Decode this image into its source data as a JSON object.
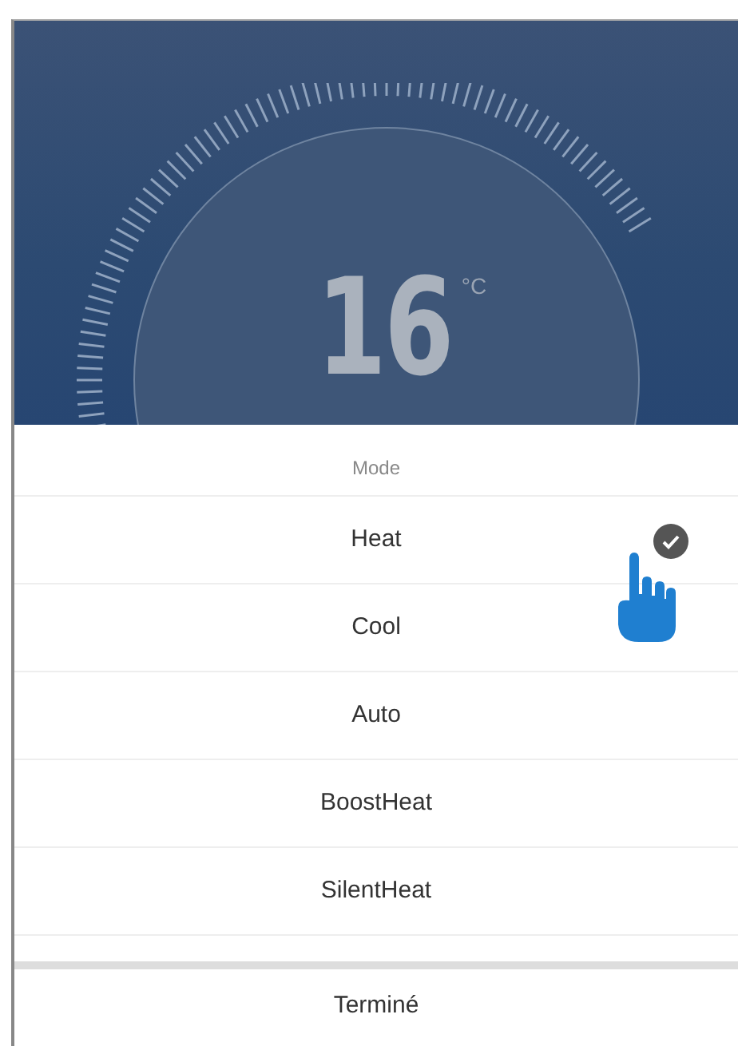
{
  "thermostat": {
    "temperature": "16",
    "unit": "°C"
  },
  "mode_sheet": {
    "title": "Mode",
    "options": [
      {
        "label": "Heat",
        "selected": true
      },
      {
        "label": "Cool",
        "selected": false
      },
      {
        "label": "Auto",
        "selected": false
      },
      {
        "label": "BoostHeat",
        "selected": false
      },
      {
        "label": "SilentHeat",
        "selected": false
      }
    ],
    "done_button": "Terminé"
  }
}
